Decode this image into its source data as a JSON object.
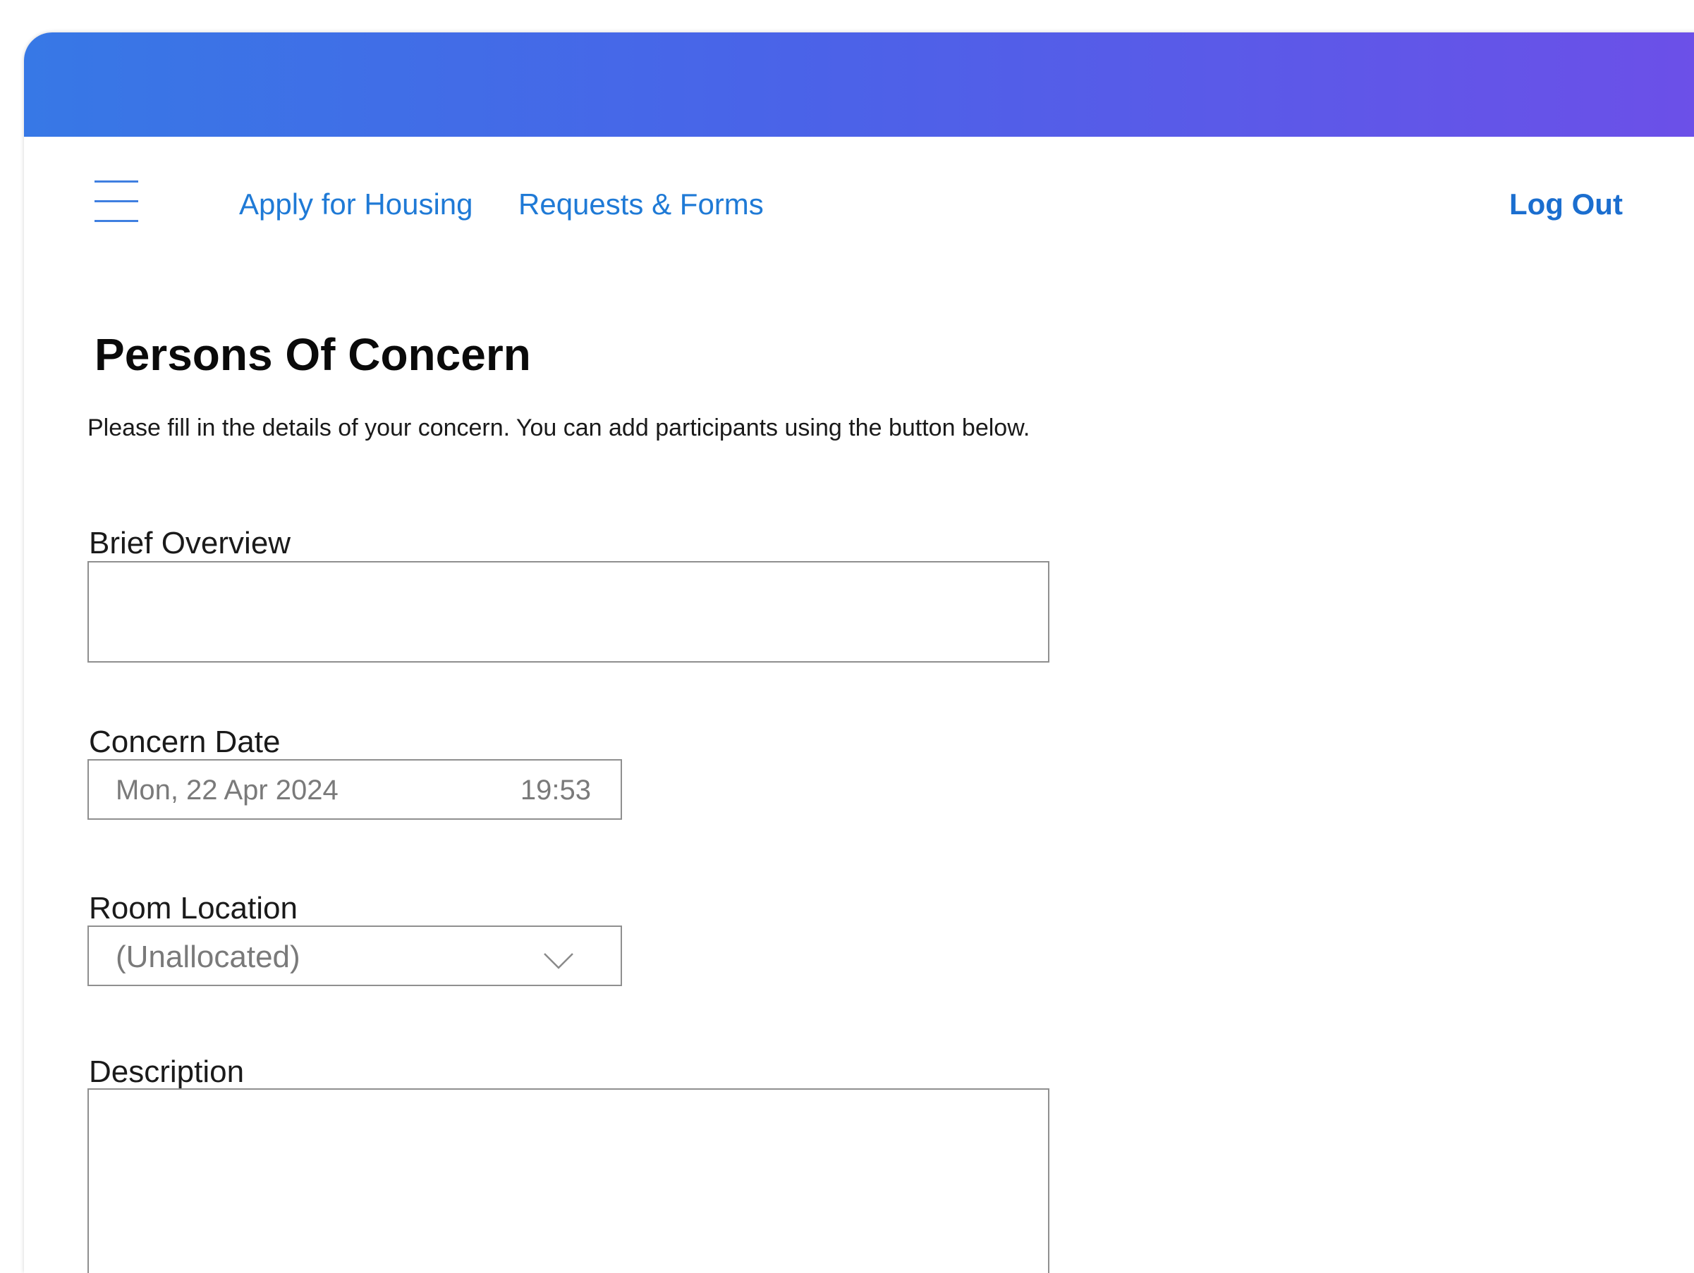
{
  "nav": {
    "links": [
      {
        "label": "Apply for Housing"
      },
      {
        "label": "Requests & Forms"
      }
    ],
    "logout_label": "Log Out"
  },
  "page": {
    "title": "Persons Of Concern",
    "intro": "Please fill in the details of your concern. You can add participants using the button below."
  },
  "form": {
    "overview": {
      "label": "Brief Overview",
      "value": ""
    },
    "concern_date": {
      "label": "Concern Date",
      "date": "Mon, 22 Apr 2024",
      "time": "19:53"
    },
    "room_location": {
      "label": "Room Location",
      "selected": "(Unallocated)"
    },
    "description": {
      "label": "Description",
      "value": ""
    }
  },
  "colors": {
    "banner_start": "#3778e6",
    "banner_end": "#6d4fe8",
    "link": "#1f7ad6"
  },
  "icons": {
    "menu": "hamburger-menu-icon",
    "dropdown": "chevron-down-icon",
    "scroll_up": "scroll-up-arrow-icon",
    "scroll_down": "scroll-down-arrow-icon"
  }
}
